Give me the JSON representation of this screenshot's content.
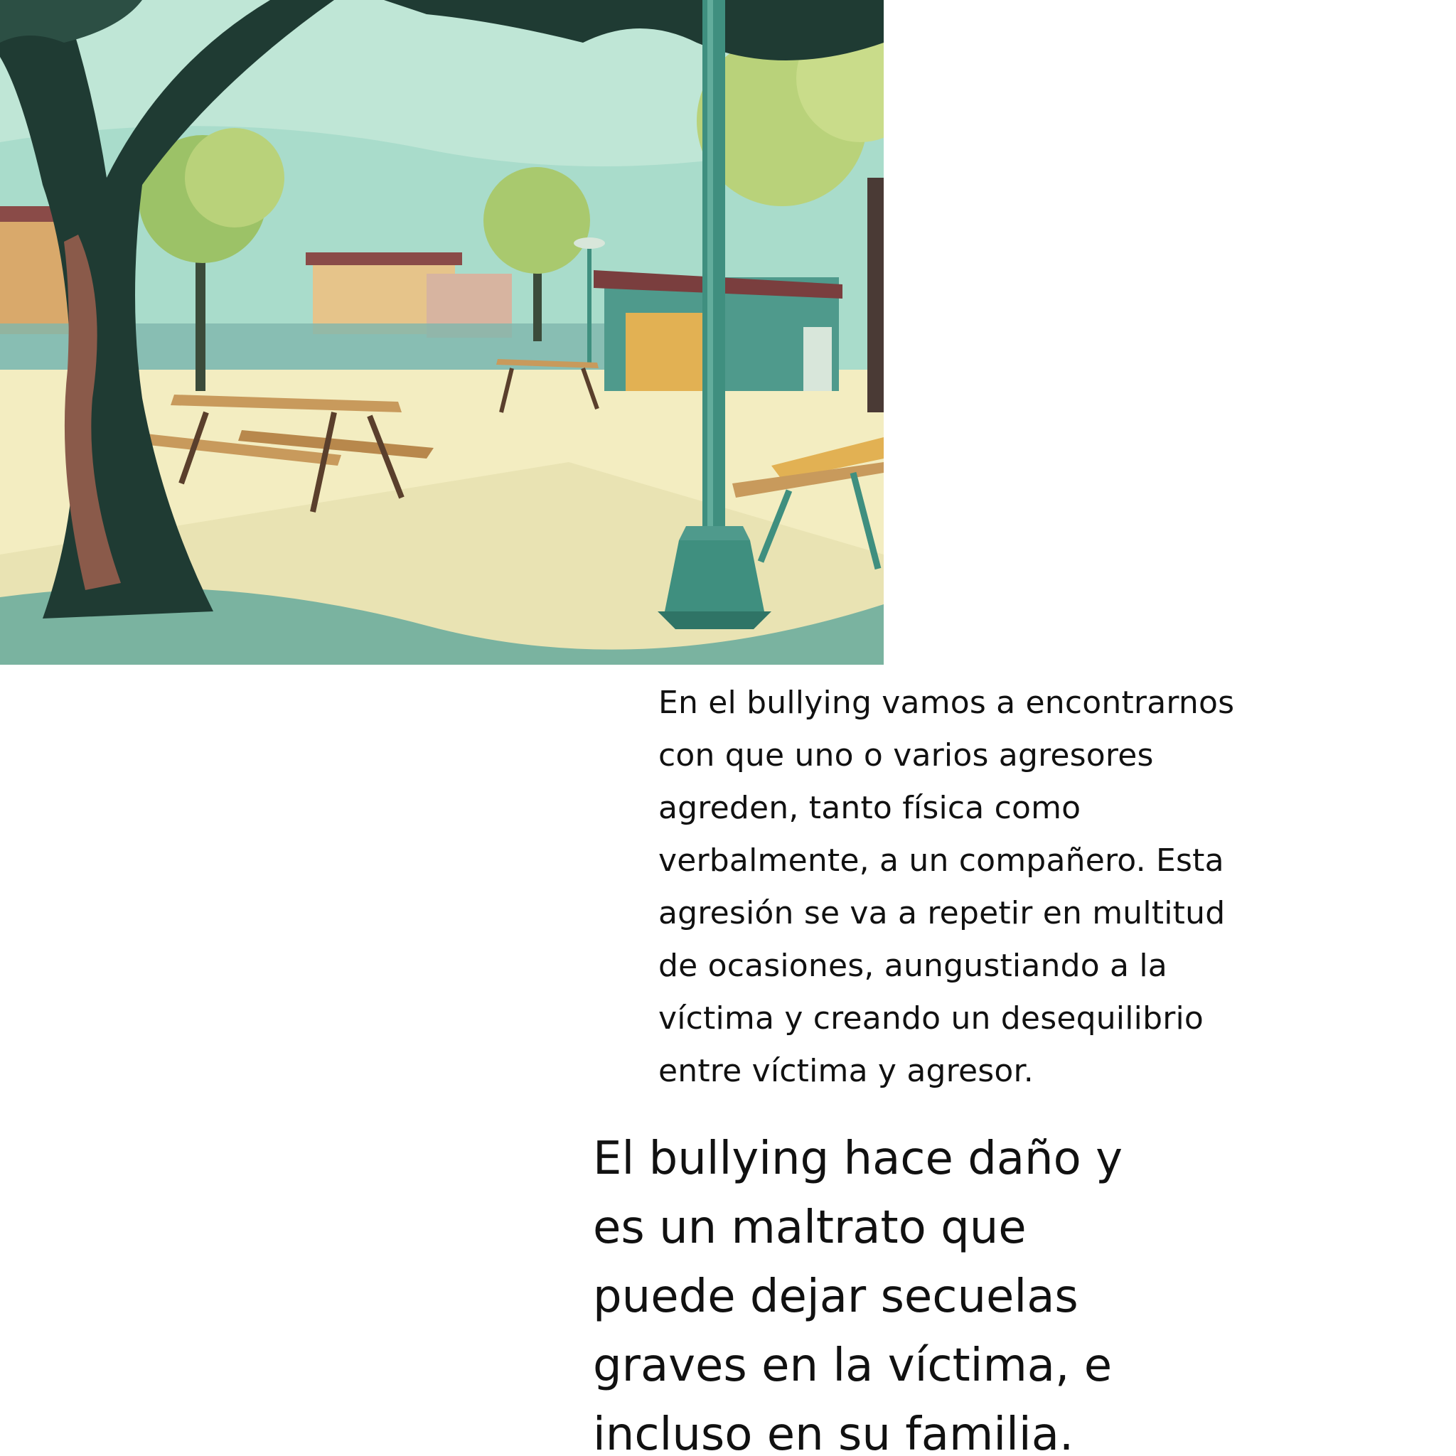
{
  "illustration": {
    "name": "schoolyard-illustration",
    "palette": {
      "sky": "#a9dccb",
      "ground": "#f3edc1",
      "tree_dark": "#1f3b33",
      "tree_light": "#b9d27a",
      "wood": "#c89a5c",
      "post": "#3f8f7f",
      "roof": "#7a3e3e"
    }
  },
  "body": {
    "lines": [
      "En el bullying vamos a encontrarnos",
      "con que uno o varios agresores",
      "agreden, tanto física como",
      "verbalmente, a un compañero. Esta",
      "agresión se va a repetir en multitud",
      "de ocasiones, aungustiando a la",
      "víctima y creando un desequilibrio",
      "entre víctima y agresor."
    ]
  },
  "headline": {
    "lines": [
      "El bullying hace daño y",
      "es un maltrato que",
      "puede dejar secuelas",
      "graves en la víctima, e",
      "incluso en su familia."
    ]
  }
}
